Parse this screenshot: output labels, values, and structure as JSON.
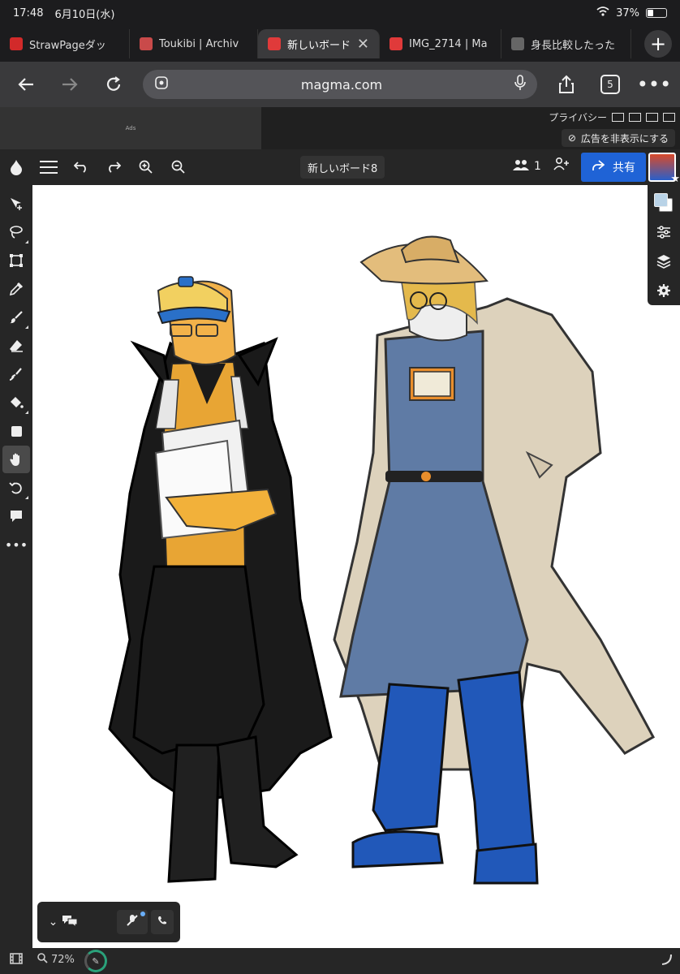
{
  "status": {
    "time": "17:48",
    "date": "6月10日(水)",
    "battery": "37%",
    "battery_level": 0.37
  },
  "tabs": [
    {
      "label": "StrawPageダッ",
      "favicon_color": "#d22a2a",
      "active": false
    },
    {
      "label": "Toukibi | Archiv",
      "favicon_color": "#c94a4a",
      "active": false
    },
    {
      "label": "新しいボード",
      "favicon_color": "#e03a3a",
      "active": true
    },
    {
      "label": "IMG_2714 | Ma",
      "favicon_color": "#e03a3a",
      "active": false
    },
    {
      "label": "身長比較したった",
      "favicon_color": "#666666",
      "active": false
    }
  ],
  "toolbar": {
    "url": "magma.com",
    "tab_count": "5",
    "icons": [
      "back-icon",
      "forward-icon",
      "reload-icon",
      "site-info-icon",
      "mic-icon",
      "share-icon",
      "more-icon"
    ]
  },
  "adbar": {
    "ads_label": "Ads",
    "privacy_label": "プライバシー",
    "hide_ads_label": "広告を非表示にする"
  },
  "app": {
    "board_name": "新しいボード8",
    "user_count": "1",
    "share_label": "共有",
    "accent": "#1f63d6"
  },
  "left_tools": [
    "move-icon",
    "lasso-icon",
    "transform-icon",
    "eyedropper-icon",
    "brush-icon",
    "eraser-icon",
    "smudge-icon",
    "fill-icon",
    "shape-icon",
    "hand-icon",
    "rotate-icon",
    "comment-icon",
    "more-tools-icon"
  ],
  "selected_tool": "hand-icon",
  "right_panel": [
    "color-swatch",
    "adjustments-icon",
    "layers-icon",
    "settings-icon"
  ],
  "colors": {
    "primary_swatch": "#b9d3e7",
    "secondary_swatch": "#ffffff"
  },
  "bottom": {
    "zoom": "72%"
  }
}
